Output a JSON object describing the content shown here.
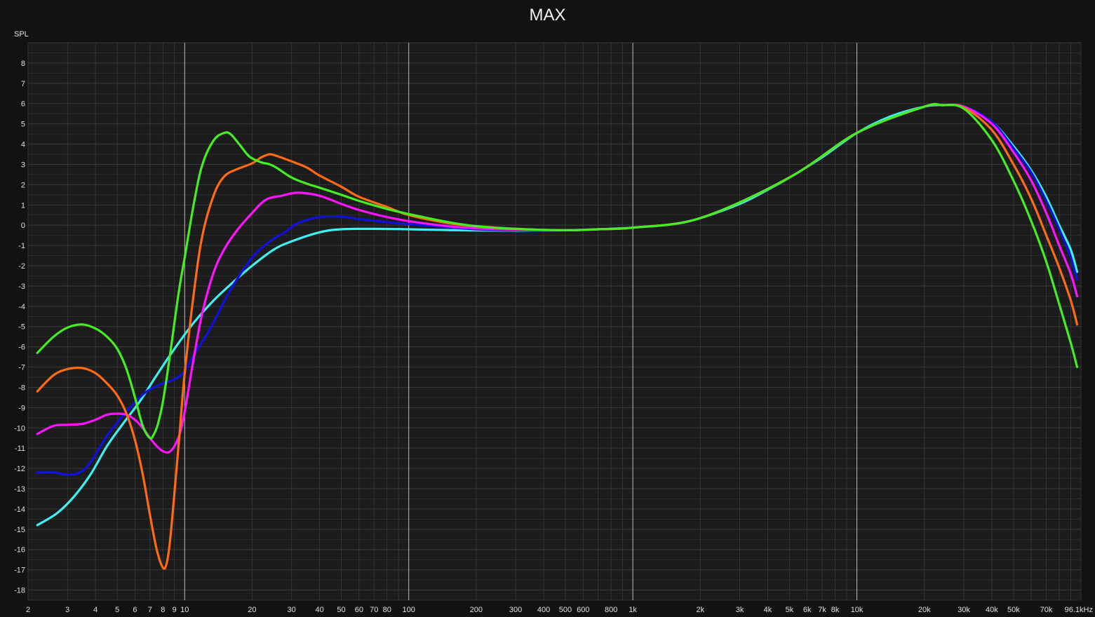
{
  "chart_data": {
    "type": "line",
    "title": "MAX",
    "ylabel": "SPL",
    "xlabel": "",
    "xscale": "log",
    "xlim": [
      2,
      100000
    ],
    "ylim": [
      -18.5,
      9
    ],
    "grid": true,
    "colors": {
      "background": "#121212",
      "plot_bg": "#1c1c1c",
      "grid": "#3a3a3a",
      "grid_major": "#bdbdbd",
      "text": "#e0e0e0"
    },
    "y_ticks": [
      {
        "v": 8,
        "label": "8"
      },
      {
        "v": 7,
        "label": "7"
      },
      {
        "v": 6,
        "label": "6"
      },
      {
        "v": 5,
        "label": "5"
      },
      {
        "v": 4,
        "label": "4"
      },
      {
        "v": 3,
        "label": "3"
      },
      {
        "v": 2,
        "label": "2"
      },
      {
        "v": 1,
        "label": "1"
      },
      {
        "v": 0,
        "label": "0"
      },
      {
        "v": -1,
        "label": "-1"
      },
      {
        "v": -2,
        "label": "-2"
      },
      {
        "v": -3,
        "label": "-3"
      },
      {
        "v": -4,
        "label": "-4"
      },
      {
        "v": -5,
        "label": "-5"
      },
      {
        "v": -6,
        "label": "-6"
      },
      {
        "v": -7,
        "label": "-7"
      },
      {
        "v": -8,
        "label": "-8"
      },
      {
        "v": -9,
        "label": "-9"
      },
      {
        "v": -10,
        "label": "-10"
      },
      {
        "v": -11,
        "label": "-11"
      },
      {
        "v": -12,
        "label": "-12"
      },
      {
        "v": -13,
        "label": "-13"
      },
      {
        "v": -14,
        "label": "-14"
      },
      {
        "v": -15,
        "label": "-15"
      },
      {
        "v": -16,
        "label": "-16"
      },
      {
        "v": -17,
        "label": "-17"
      },
      {
        "v": -18,
        "label": "-18"
      }
    ],
    "x_ticks": [
      {
        "v": 2,
        "label": "2"
      },
      {
        "v": 3,
        "label": "3"
      },
      {
        "v": 4,
        "label": "4"
      },
      {
        "v": 5,
        "label": "5"
      },
      {
        "v": 6,
        "label": "6"
      },
      {
        "v": 7,
        "label": "7"
      },
      {
        "v": 8,
        "label": "8"
      },
      {
        "v": 9,
        "label": "9"
      },
      {
        "v": 10,
        "label": "10"
      },
      {
        "v": 20,
        "label": "20"
      },
      {
        "v": 30,
        "label": "30"
      },
      {
        "v": 40,
        "label": "40"
      },
      {
        "v": 50,
        "label": "50"
      },
      {
        "v": 60,
        "label": "60"
      },
      {
        "v": 70,
        "label": "70"
      },
      {
        "v": 80,
        "label": "80"
      },
      {
        "v": 100,
        "label": "100"
      },
      {
        "v": 200,
        "label": "200"
      },
      {
        "v": 300,
        "label": "300"
      },
      {
        "v": 400,
        "label": "400"
      },
      {
        "v": 500,
        "label": "500"
      },
      {
        "v": 600,
        "label": "600"
      },
      {
        "v": 800,
        "label": "800"
      },
      {
        "v": 1000,
        "label": "1k"
      },
      {
        "v": 2000,
        "label": "2k"
      },
      {
        "v": 3000,
        "label": "3k"
      },
      {
        "v": 4000,
        "label": "4k"
      },
      {
        "v": 5000,
        "label": "5k"
      },
      {
        "v": 6000,
        "label": "6k"
      },
      {
        "v": 7000,
        "label": "7k"
      },
      {
        "v": 8000,
        "label": "8k"
      },
      {
        "v": 10000,
        "label": "10k"
      },
      {
        "v": 20000,
        "label": "20k"
      },
      {
        "v": 30000,
        "label": "30k"
      },
      {
        "v": 40000,
        "label": "40k"
      },
      {
        "v": 50000,
        "label": "50k"
      },
      {
        "v": 70000,
        "label": "70k"
      },
      {
        "v": 96100,
        "label": "96.1kHz"
      }
    ],
    "series": [
      {
        "color": "#40f0f0",
        "x": [
          2.2,
          2.7,
          3.2,
          3.8,
          4.5,
          5.3,
          6.3,
          7.5,
          9,
          11,
          13.5,
          16.5,
          20,
          25,
          30,
          40,
          50,
          70,
          100,
          150,
          200,
          300,
          500,
          700,
          1000,
          1500,
          2000,
          3000,
          4000,
          5000,
          7000,
          10000,
          14000,
          20000,
          24000,
          30000,
          40000,
          50000,
          60000,
          70000,
          80000,
          90000,
          96100
        ],
        "y": [
          -14.8,
          -14.2,
          -13.4,
          -12.3,
          -10.9,
          -9.8,
          -8.7,
          -7.4,
          -6.1,
          -4.8,
          -3.7,
          -2.8,
          -2.0,
          -1.2,
          -0.8,
          -0.35,
          -0.2,
          -0.18,
          -0.2,
          -0.24,
          -0.26,
          -0.27,
          -0.25,
          -0.2,
          -0.12,
          0.05,
          0.35,
          1.05,
          1.75,
          2.35,
          3.35,
          4.55,
          5.35,
          5.85,
          5.92,
          5.85,
          5.1,
          3.9,
          2.7,
          1.4,
          0,
          -1.2,
          -2.3
        ]
      },
      {
        "color": "#1010e0",
        "x": [
          2.2,
          2.6,
          3.0,
          3.4,
          3.8,
          4.5,
          5.3,
          6.3,
          7.0,
          8.0,
          9.0,
          10,
          11,
          13,
          16,
          20,
          24,
          28,
          32,
          40,
          50,
          60,
          80,
          100,
          150,
          200,
          300,
          500,
          700,
          1000,
          2000,
          5000,
          10000,
          20000,
          24000,
          30000,
          40000,
          50000,
          60000,
          70000,
          80000,
          90000,
          96100
        ],
        "y": [
          -12.2,
          -12.2,
          -12.3,
          -12.2,
          -11.7,
          -10.4,
          -9.4,
          -8.5,
          -8.1,
          -7.8,
          -7.6,
          -7.2,
          -6.4,
          -5.1,
          -3.2,
          -1.6,
          -0.8,
          -0.35,
          0.1,
          0.4,
          0.42,
          0.3,
          0.15,
          0.05,
          -0.1,
          -0.2,
          -0.25,
          -0.25,
          -0.2,
          -0.12,
          0.35,
          2.35,
          4.55,
          5.85,
          5.92,
          5.85,
          5.1,
          3.8,
          2.6,
          1.2,
          -0.2,
          -1.6,
          -2.7
        ]
      },
      {
        "color": "#ff14ff",
        "x": [
          2.2,
          2.6,
          3.0,
          3.5,
          4.0,
          4.5,
          5.0,
          5.5,
          6.0,
          6.5,
          7.0,
          7.5,
          8.0,
          8.5,
          9.0,
          9.5,
          10,
          11,
          12,
          13.5,
          15,
          17,
          20,
          23,
          27,
          32,
          40,
          50,
          60,
          80,
          100,
          150,
          200,
          300,
          500,
          700,
          1000,
          2000,
          5000,
          10000,
          20000,
          24000,
          30000,
          40000,
          50000,
          60000,
          70000,
          80000,
          90000,
          96100
        ],
        "y": [
          -10.3,
          -9.9,
          -9.85,
          -9.8,
          -9.6,
          -9.35,
          -9.3,
          -9.35,
          -9.6,
          -10.0,
          -10.5,
          -10.9,
          -11.15,
          -11.2,
          -10.9,
          -10.3,
          -9.2,
          -6.5,
          -4.3,
          -2.3,
          -1.2,
          -0.3,
          0.6,
          1.25,
          1.45,
          1.6,
          1.45,
          1.05,
          0.75,
          0.4,
          0.2,
          -0.05,
          -0.15,
          -0.22,
          -0.25,
          -0.2,
          -0.12,
          0.35,
          2.35,
          4.55,
          5.85,
          5.92,
          5.85,
          5.0,
          3.6,
          2.2,
          0.6,
          -1.0,
          -2.4,
          -3.5
        ]
      },
      {
        "color": "#ff6a14",
        "x": [
          2.2,
          2.6,
          3.0,
          3.5,
          4.0,
          4.5,
          5.0,
          5.5,
          6.0,
          6.5,
          7.0,
          7.5,
          8.0,
          8.3,
          8.6,
          9.0,
          9.5,
          10,
          11,
          12,
          13.5,
          15,
          17,
          20,
          22,
          24,
          26,
          30,
          35,
          40,
          50,
          60,
          80,
          100,
          150,
          200,
          300,
          500,
          700,
          1000,
          2000,
          5000,
          10000,
          20000,
          24000,
          30000,
          40000,
          50000,
          60000,
          70000,
          80000,
          90000,
          96100
        ],
        "y": [
          -8.2,
          -7.4,
          -7.1,
          -7.05,
          -7.3,
          -7.8,
          -8.4,
          -9.3,
          -10.6,
          -12.3,
          -14.3,
          -16.0,
          -16.9,
          -16.7,
          -15.6,
          -13.2,
          -10.2,
          -7.3,
          -3.3,
          -0.5,
          1.5,
          2.4,
          2.75,
          3.05,
          3.35,
          3.5,
          3.4,
          3.15,
          2.85,
          2.45,
          1.9,
          1.4,
          0.9,
          0.5,
          0.1,
          -0.05,
          -0.18,
          -0.25,
          -0.2,
          -0.12,
          0.35,
          2.35,
          4.55,
          5.85,
          5.92,
          5.8,
          4.7,
          3.0,
          1.3,
          -0.5,
          -2.1,
          -3.7,
          -4.9
        ]
      },
      {
        "color": "#44ee22",
        "x": [
          2.2,
          2.6,
          3.0,
          3.5,
          4.0,
          4.5,
          5.0,
          5.5,
          6.0,
          6.5,
          7.0,
          7.3,
          7.6,
          8.0,
          8.5,
          9.0,
          9.5,
          10,
          11,
          12,
          13.5,
          15,
          16,
          17.5,
          19,
          20,
          22,
          24,
          26,
          30,
          35,
          40,
          50,
          60,
          80,
          100,
          150,
          200,
          300,
          500,
          700,
          1000,
          2000,
          5000,
          10000,
          20000,
          24000,
          30000,
          40000,
          50000,
          60000,
          70000,
          80000,
          90000,
          96100
        ],
        "y": [
          -6.3,
          -5.5,
          -5.05,
          -4.9,
          -5.1,
          -5.5,
          -6.1,
          -7.1,
          -8.5,
          -9.9,
          -10.5,
          -10.3,
          -9.8,
          -8.7,
          -6.8,
          -4.8,
          -3.0,
          -1.6,
          1.1,
          3.0,
          4.2,
          4.55,
          4.5,
          4.0,
          3.5,
          3.3,
          3.1,
          3.0,
          2.8,
          2.35,
          2.05,
          1.85,
          1.5,
          1.2,
          0.8,
          0.55,
          0.15,
          -0.05,
          -0.18,
          -0.25,
          -0.2,
          -0.12,
          0.35,
          2.35,
          4.55,
          5.85,
          5.92,
          5.75,
          4.2,
          2.2,
          0.2,
          -1.8,
          -3.9,
          -5.8,
          -7.0
        ]
      }
    ]
  }
}
